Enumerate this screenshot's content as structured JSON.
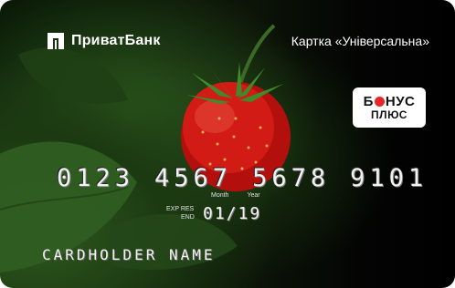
{
  "card": {
    "bank_name": "ПриватБанк",
    "card_type": "Картка «Універсальна»",
    "bonus": {
      "top": "БОНУС",
      "top_a": "Б",
      "top_b": "НУС",
      "bottom": "ПЛЮС",
      "dot_color": "#e8262a"
    },
    "number_groups": [
      "0123",
      "4567",
      "5678",
      "9101"
    ],
    "expiry": {
      "month_caption": "Month",
      "year_caption": "Year",
      "label_line1": "EXP RES",
      "label_line2": "END",
      "date": "01/19"
    },
    "holder": "CARDHOLDER NAME",
    "image_subject": "strawberry-icon"
  }
}
